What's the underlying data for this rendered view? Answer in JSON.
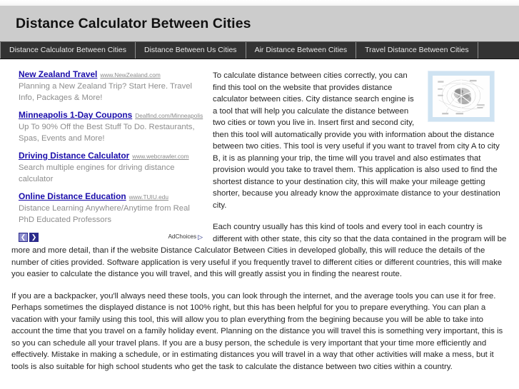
{
  "header": {
    "title": "Distance Calculator Between Cities"
  },
  "nav": {
    "items": [
      {
        "label": "Distance Calculator Between Cities"
      },
      {
        "label": "Distance Between Us Cities"
      },
      {
        "label": "Air Distance Between Cities"
      },
      {
        "label": "Travel Distance Between Cities"
      }
    ]
  },
  "ads": {
    "units": [
      {
        "title": "New Zealand Travel",
        "url": "www.NewZealand.com",
        "description": "Planning a New Zealand Trip? Start Here. Travel Info, Packages & More!"
      },
      {
        "title": "Minneapolis 1-Day Coupons",
        "url": "Dealfind.com/Minneapolis",
        "description": "Up To 90% Off the Best Stuff To Do. Restaurants, Spas, Events and More!"
      },
      {
        "title": "Driving Distance Calculator",
        "url": "www.webcrawler.com",
        "description": "Search multiple engines for driving distance calculator"
      },
      {
        "title": "Online Distance Education",
        "url": "www.TUIU.edu",
        "description": "Distance Learning Anywhere/Anytime from Real PhD Educated Professors"
      }
    ],
    "prev_arrow": "❮",
    "next_arrow": "❯",
    "adchoices_label": "AdChoices",
    "adchoices_glyph": "▷"
  },
  "main": {
    "paragraph1": "To calculate distance between cities correctly, you can find this tool on the website that provides distance calculator between cities. City distance search engine is a tool that will help you calculate the distance between two cities or town you live in. Insert first and second city, then this tool will automatically provide you with information about the distance between two cities. This tool is very useful if you want to travel from city A to city B, it is as planning your trip, the time will you travel and also estimates that provision would you take to travel them. This application is also used to find the shortest distance to your destination city, this will make your mileage getting shorter, because you already know the approximate distance to your destination city.",
    "paragraph2": "Each country usually has this kind of tools and every tool in each country is different with other state, this city so that the data contained in the program will be more and more detail, than if the website Distance Calculator Between Cities in developed globally, this will reduce the details of the number of cities provided. Software application is very useful if you frequently travel to different cities or different countries, this will make you easier to calculate the distance you will travel, and this will greatly assist you in finding the nearest route.",
    "paragraph3": "If you are a backpacker, you'll always need these tools, you can look through the internet, and the average tools you can use it for free. Perhaps sometimes the displayed distance is not 100% right, but this has been helpful for you to prepare everything. You can plan a vacation with your family using this tool, this will allow you to plan everything from the begining because you will be able to take into account the time that you travel on a family holiday event. Planning on the distance you will travel this is something very important, this is so you can schedule all your travel plans. If you are a busy person, the schedule is very important that your time more efficiently and effectively. Mistake in making a schedule, or in estimating distances you will travel in a way that other activities will make a mess, but it tools is also suitable for high school students who get the task to calculate the distance between two cities within a country."
  },
  "colors": {
    "header_bg": "#cccccc",
    "nav_bg": "#333333",
    "ad_title": "#1a0dab",
    "ad_desc": "#8d8d8d",
    "map_border": "#cfe3f2"
  }
}
